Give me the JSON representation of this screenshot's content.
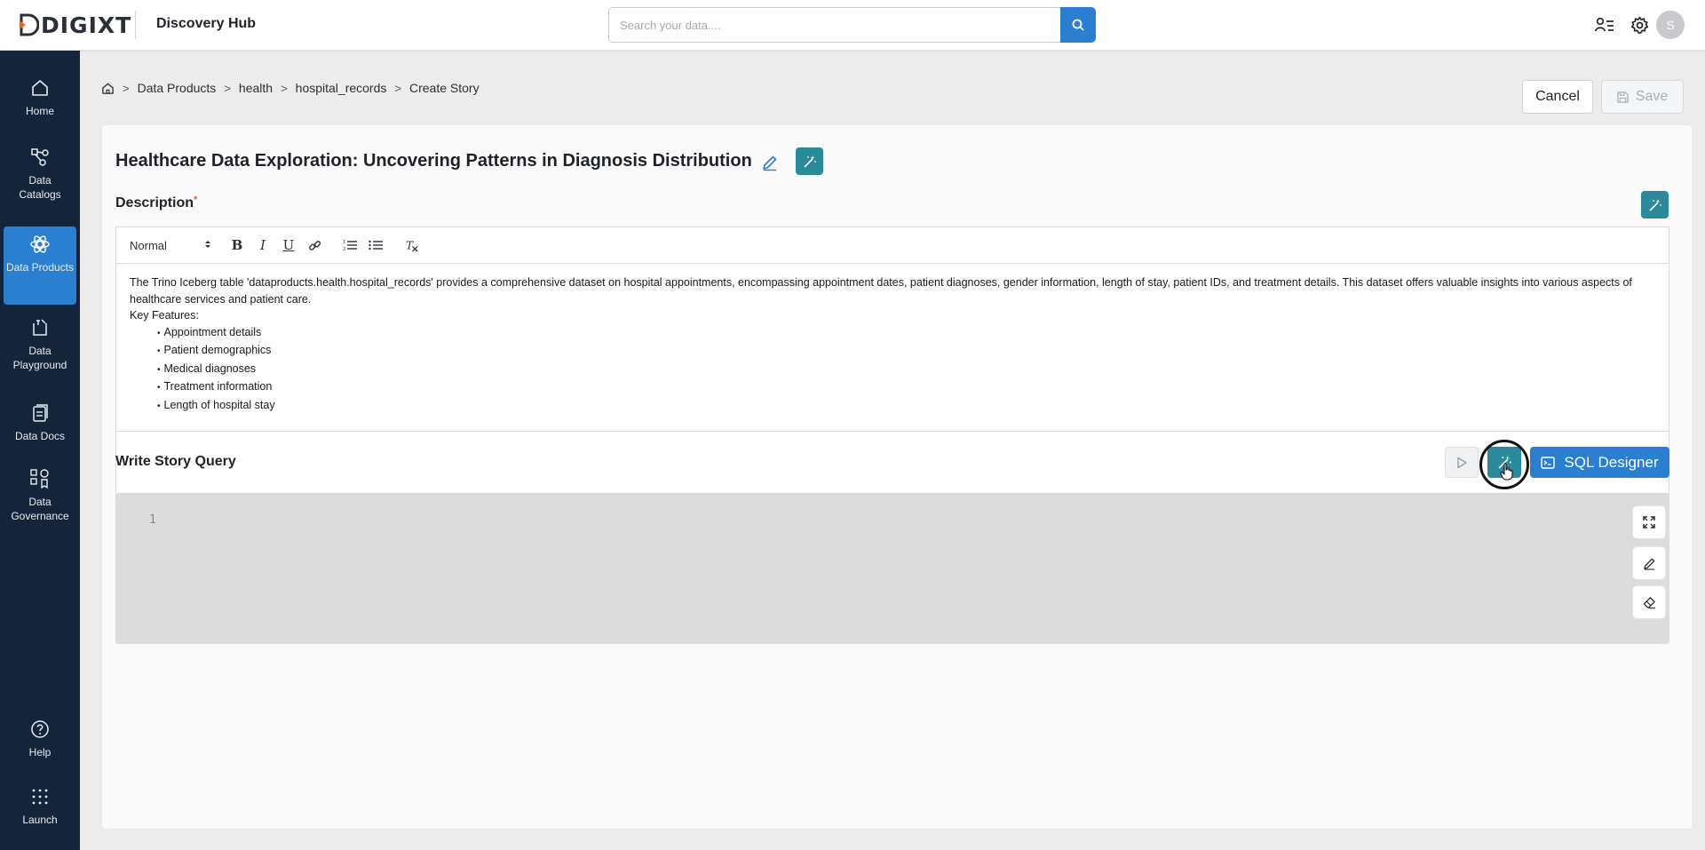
{
  "header": {
    "logo_text": "DIGIXT",
    "app_title": "Discovery Hub",
    "search_placeholder": "Search your data....",
    "avatar_initial": "S"
  },
  "sidebar": {
    "items": [
      {
        "label": "Home",
        "icon": "home-icon"
      },
      {
        "label": "Data Catalogs",
        "icon": "catalog-icon"
      },
      {
        "label": "Data Products",
        "icon": "products-icon",
        "active": true
      },
      {
        "label": "Data Playground",
        "icon": "playground-icon"
      },
      {
        "label": "Data Docs",
        "icon": "docs-icon"
      },
      {
        "label": "Data Governance",
        "icon": "governance-icon"
      }
    ],
    "bottom": [
      {
        "label": "Help",
        "icon": "help-icon"
      },
      {
        "label": "Launch",
        "icon": "launch-icon"
      }
    ]
  },
  "breadcrumb": [
    "Data Products",
    "health",
    "hospital_records",
    "Create Story"
  ],
  "actions": {
    "cancel": "Cancel",
    "save": "Save"
  },
  "story": {
    "title": "Healthcare Data Exploration: Uncovering Patterns in Diagnosis Distribution",
    "description_label": "Description",
    "required_mark": "*",
    "format_select": "Normal",
    "description_paragraph": "The Trino Iceberg table 'dataproducts.health.hospital_records' provides a comprehensive dataset on hospital appointments, encompassing appointment dates, patient diagnoses, gender information, length of stay, patient IDs, and treatment details. This dataset offers valuable insights into various aspects of healthcare services and patient care.",
    "key_features_label": "Key Features:",
    "key_features": [
      "Appointment details",
      "Patient demographics",
      "Medical diagnoses",
      "Treatment information",
      "Length of hospital stay"
    ]
  },
  "query": {
    "label": "Write Story Query",
    "sql_designer": "SQL Designer",
    "line_number": "1"
  },
  "colors": {
    "sidebar_bg": "#14243a",
    "primary": "#2b7fd0",
    "teal": "#2b8a99"
  }
}
